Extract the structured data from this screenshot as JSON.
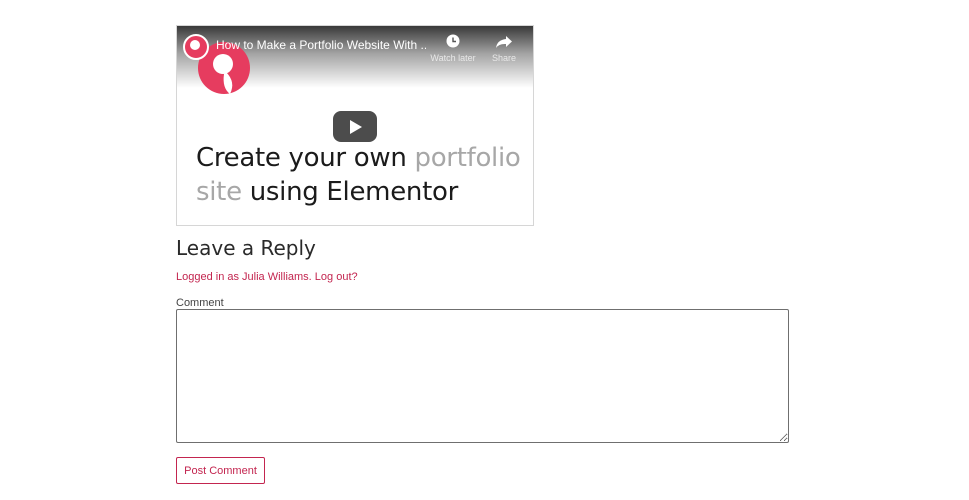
{
  "video": {
    "title": "How to Make a Portfolio Website With ...",
    "watch_later_label": "Watch later",
    "share_label": "Share",
    "headline_part1": "Create your own ",
    "headline_part2": "portfolio",
    "headline_part3": "site",
    "headline_part4": " using Elementor",
    "brand_color": "#e63c5f",
    "icons": [
      "channel-avatar",
      "clock-icon",
      "share-icon",
      "brand-logo",
      "play-icon"
    ]
  },
  "reply": {
    "title": "Leave a Reply",
    "logged_in_prefix": "Logged in as Julia Williams",
    "logged_in_sep": ". ",
    "logout_label": "Log out?",
    "comment_label": "Comment",
    "comment_value": "",
    "submit_label": "Post Comment",
    "accent_color": "#c3254f"
  }
}
